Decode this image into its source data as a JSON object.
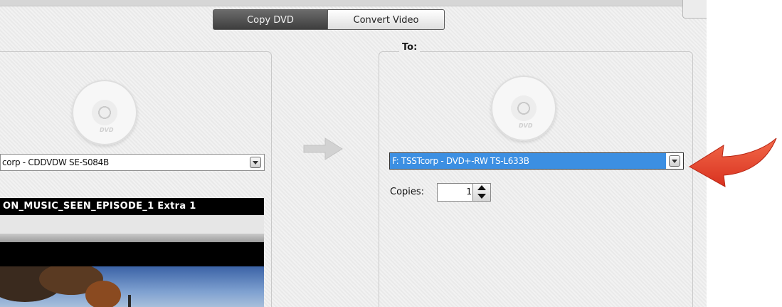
{
  "tabs": [
    {
      "label": "Copy DVD",
      "active": true
    },
    {
      "label": "Convert Video",
      "active": false
    }
  ],
  "source": {
    "drive": "corp - CDDVDW SE-S084B",
    "video_title": "ON_MUSIC_SEEN_EPISODE_1 Extra 1"
  },
  "target": {
    "legend": "To:",
    "drive": "F: TSSTcorp - DVD+-RW TS-L633B",
    "copies_label": "Copies:",
    "copies_value": "1"
  },
  "disc_icon_text": "DVD",
  "colors": {
    "selection": "#3c8fe2",
    "annotation_arrow": "#e8402a",
    "tab_active": "#4a4a4a"
  },
  "icons": [
    "dvd-disc-icon",
    "arrow-right-icon",
    "dropdown-arrow-icon",
    "stepper-up-icon",
    "stepper-down-icon",
    "annotation-arrow-icon"
  ]
}
